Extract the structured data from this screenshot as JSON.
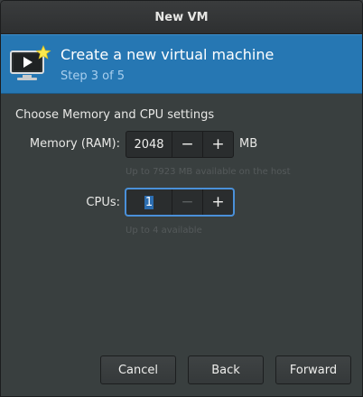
{
  "window": {
    "title": "New VM"
  },
  "banner": {
    "title": "Create a new virtual machine",
    "step": "Step 3 of 5",
    "icon": "monitor-play-icon"
  },
  "section": {
    "heading": "Choose Memory and CPU settings"
  },
  "memory": {
    "label": "Memory (RAM):",
    "value": "2048",
    "unit": "MB",
    "hint": "Up to 7923 MB available on the host"
  },
  "cpus": {
    "label": "CPUs:",
    "value": "1",
    "hint": "Up to 4 available"
  },
  "controls": {
    "minus": "−",
    "plus": "+"
  },
  "buttons": {
    "cancel": "Cancel",
    "back": "Back",
    "forward": "Forward"
  }
}
